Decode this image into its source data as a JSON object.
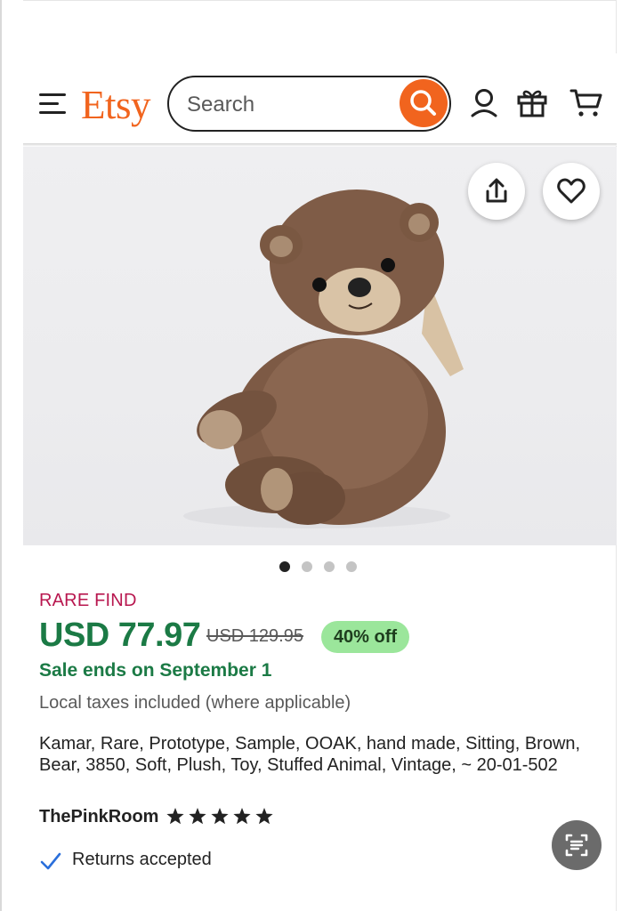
{
  "header": {
    "logo": "Etsy",
    "search_placeholder": "Search",
    "colors": {
      "brand": "#f1641e"
    },
    "icons": [
      "menu-icon",
      "search-icon",
      "account-icon",
      "gift-icon",
      "cart-icon"
    ]
  },
  "listing": {
    "image_icons": [
      "share-icon",
      "heart-icon"
    ],
    "carousel": {
      "total": 4,
      "active": 1
    },
    "rare_label": "RARE FIND",
    "price": "USD 77.97",
    "original_price": "USD 129.95",
    "discount_badge": "40% off",
    "sale_ends": "Sale ends on September 1",
    "taxes_note": "Local taxes included (where applicable)",
    "title": "Kamar, Rare, Prototype, Sample, OOAK, hand made, Sitting, Brown, Bear, 3850, Soft, Plush, Toy, Stuffed Animal, Vintage, ~ 20-01-502",
    "shop_name": "ThePinkRoom",
    "rating": 5,
    "returns": "Returns accepted",
    "colors": {
      "sale_green": "#1b7a45",
      "rare_pink": "#b8174f",
      "badge_bg": "#9be69b"
    }
  }
}
